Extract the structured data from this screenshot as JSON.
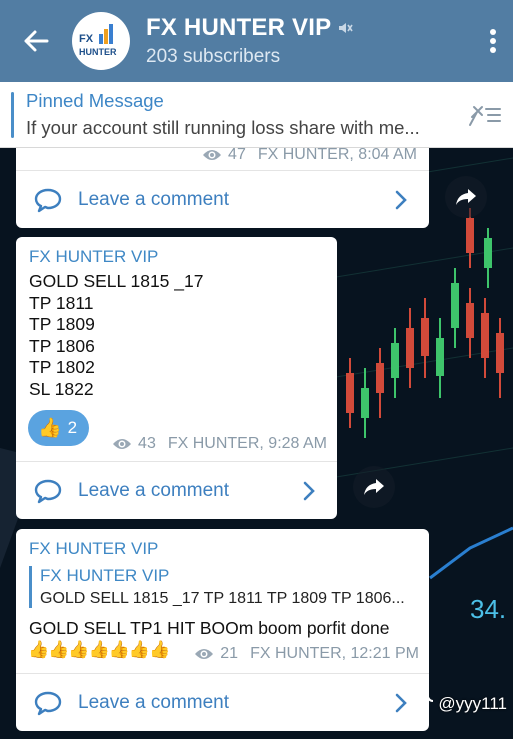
{
  "header": {
    "title": "FX HUNTER VIP",
    "subscribers": "203 subscribers",
    "avatar_top": "FX",
    "avatar_bottom": "HUNTER"
  },
  "pinned": {
    "title": "Pinned Message",
    "text": "If your account still running loss share with me..."
  },
  "messages": [
    {
      "views": "47",
      "author": "FX HUNTER, 8:04 AM",
      "comment_label": "Leave a comment"
    },
    {
      "sender": "FX HUNTER VIP",
      "lines": [
        "GOLD SELL 1815 _17",
        "TP 1811",
        "TP 1809",
        "TP 1806",
        "TP 1802",
        "SL 1822"
      ],
      "reaction_emoji": "👍",
      "reaction_count": "2",
      "views": "43",
      "author": "FX HUNTER, 9:28 AM",
      "comment_label": "Leave a comment"
    },
    {
      "sender": "FX HUNTER VIP",
      "reply_sender": "FX HUNTER VIP",
      "reply_text": "GOLD SELL 1815 _17 TP 1811 TP 1809 TP 1806...",
      "text": "GOLD SELL TP1 HIT BOOm boom porfit done",
      "emojis": "👍👍👍👍👍👍👍",
      "views": "21",
      "author": "FX HUNTER, 12:21 PM",
      "comment_label": "Leave a comment"
    }
  ],
  "background_number": "34.",
  "watermark": "@yyy111",
  "colors": {
    "header": "#527da3",
    "accent": "#3d86c6",
    "reaction": "#5aa3e0"
  },
  "icons": {
    "back": "arrow-left-icon",
    "mute": "muted-speaker-icon",
    "menu": "more-vertical-icon",
    "pinned": "pinned-list-icon",
    "views": "eye-icon",
    "comment": "speech-bubble-icon",
    "chevron": "chevron-right-icon",
    "forward": "share-arrow-icon"
  }
}
